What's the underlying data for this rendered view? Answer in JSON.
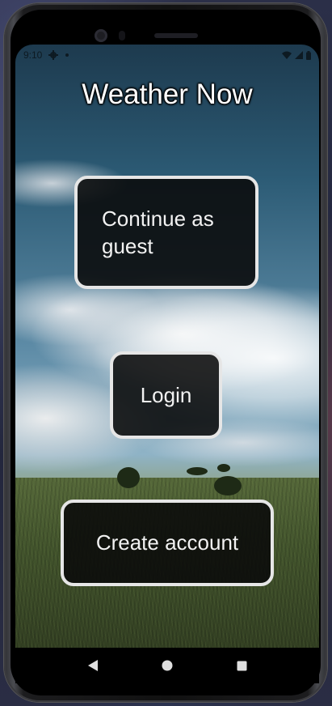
{
  "status_bar": {
    "time": "9:10"
  },
  "app": {
    "title": "Weather Now"
  },
  "buttons": {
    "guest": "Continue as guest",
    "login": "Login",
    "create_account": "Create account"
  },
  "nav": {
    "back_icon": "back-triangle-icon",
    "home_icon": "home-circle-icon",
    "recents_icon": "recents-square-icon"
  },
  "colors": {
    "button_bg": "#0a0a0a",
    "button_border": "#e6e6e6",
    "title_text": "#ffffff"
  }
}
